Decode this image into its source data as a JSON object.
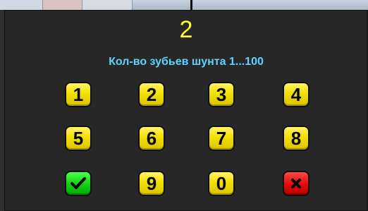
{
  "dialog": {
    "display_value": "2",
    "prompt": "Кол-во зубьев шунта 1...100"
  },
  "keypad": {
    "keys": [
      {
        "label": "1"
      },
      {
        "label": "2"
      },
      {
        "label": "3"
      },
      {
        "label": "4"
      },
      {
        "label": "5"
      },
      {
        "label": "6"
      },
      {
        "label": "7"
      },
      {
        "label": "8"
      },
      {
        "label": "",
        "icon": "checkmark-icon"
      },
      {
        "label": "9"
      },
      {
        "label": "0"
      },
      {
        "label": "",
        "icon": "close-icon"
      }
    ]
  },
  "colors": {
    "display": "#ffff33",
    "prompt": "#5fd2ff",
    "key": "#f2df00",
    "ok_key": "#14d414",
    "cancel_key": "#e80c0c"
  }
}
